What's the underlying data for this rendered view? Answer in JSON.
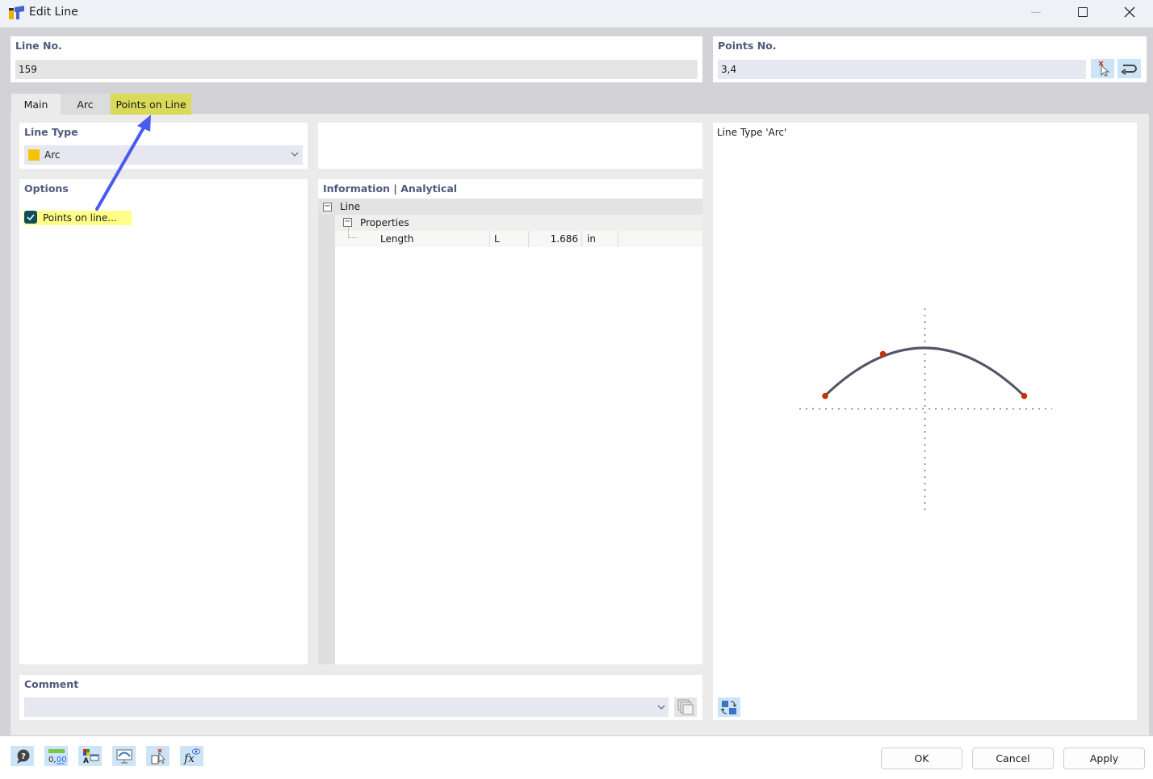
{
  "window": {
    "title": "Edit Line",
    "icon": "line-app-icon",
    "controls": [
      "minimize-icon",
      "maximize-icon",
      "close-icon"
    ]
  },
  "line_no": {
    "label": "Line No.",
    "value": "159"
  },
  "points_no": {
    "label": "Points No.",
    "value": "3,4",
    "buttons": [
      "pick-points-icon",
      "reverse-icon"
    ]
  },
  "tabs": [
    {
      "label": "Main",
      "active": true
    },
    {
      "label": "Arc",
      "active": false
    },
    {
      "label": "Points on Line",
      "active": false,
      "highlighted": true
    }
  ],
  "line_type": {
    "label": "Line Type",
    "value": "Arc",
    "swatch_color": "#f5c400"
  },
  "options": {
    "label": "Options",
    "items": [
      {
        "label": "Points on line...",
        "checked": true,
        "highlighted": true
      }
    ]
  },
  "information": {
    "label": "Information | Analytical",
    "tree": [
      {
        "label": "Line",
        "level": 0,
        "expanded": true
      },
      {
        "label": "Properties",
        "level": 1,
        "expanded": true
      },
      {
        "label": "Length",
        "level": 2,
        "symbol": "L",
        "value": "1.686",
        "unit": "in"
      }
    ]
  },
  "preview": {
    "title": "Line Type 'Arc'",
    "arc_color": "#54546a",
    "point_color": "#c83200"
  },
  "comment": {
    "label": "Comment",
    "value": ""
  },
  "footer_tools": [
    "help-icon",
    "units-icon",
    "display-settings-icon",
    "view-icon",
    "select-delete-icon",
    "formula-icon"
  ],
  "buttons": {
    "ok": "OK",
    "cancel": "Cancel",
    "apply": "Apply"
  },
  "annotation": {
    "arrow_color": "#4a5cf0"
  }
}
